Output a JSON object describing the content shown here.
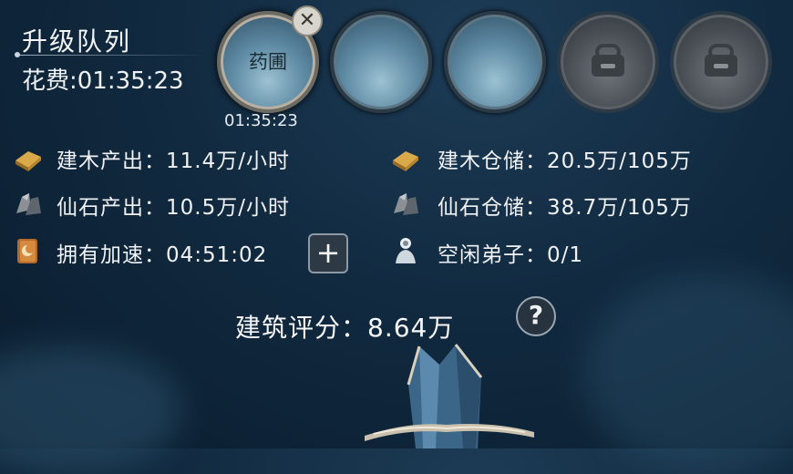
{
  "title": "升级队列",
  "cost_label": "花费:01:35:23",
  "queue": [
    {
      "label": "药圃",
      "state": "active"
    },
    {
      "label": "",
      "state": "empty"
    },
    {
      "label": "",
      "state": "empty"
    },
    {
      "label": "",
      "state": "locked"
    },
    {
      "label": "",
      "state": "locked"
    }
  ],
  "queue_timer": "01:35:23",
  "close_symbol": "✕",
  "stats": {
    "wood_output": "建木产出：11.4万/小时",
    "wood_storage": "建木仓储：20.5万/105万",
    "stone_output": "仙石产出：10.5万/小时",
    "stone_storage": "仙石仓储：38.7万/105万",
    "speedup": "拥有加速：04:51:02",
    "idle_disciples": "空闲弟子：0/1"
  },
  "plus_symbol": "+",
  "score": "建筑评分：8.64万",
  "help_symbol": "?",
  "icons": {
    "wood": "wood-plank-icon",
    "stone": "stone-ore-icon",
    "speedup": "moon-book-icon",
    "disciple": "disciple-figure-icon"
  },
  "colors": {
    "accent": "#f2f4f6",
    "background": "#112a40",
    "slot_active_rim": "#b9b0a2"
  }
}
